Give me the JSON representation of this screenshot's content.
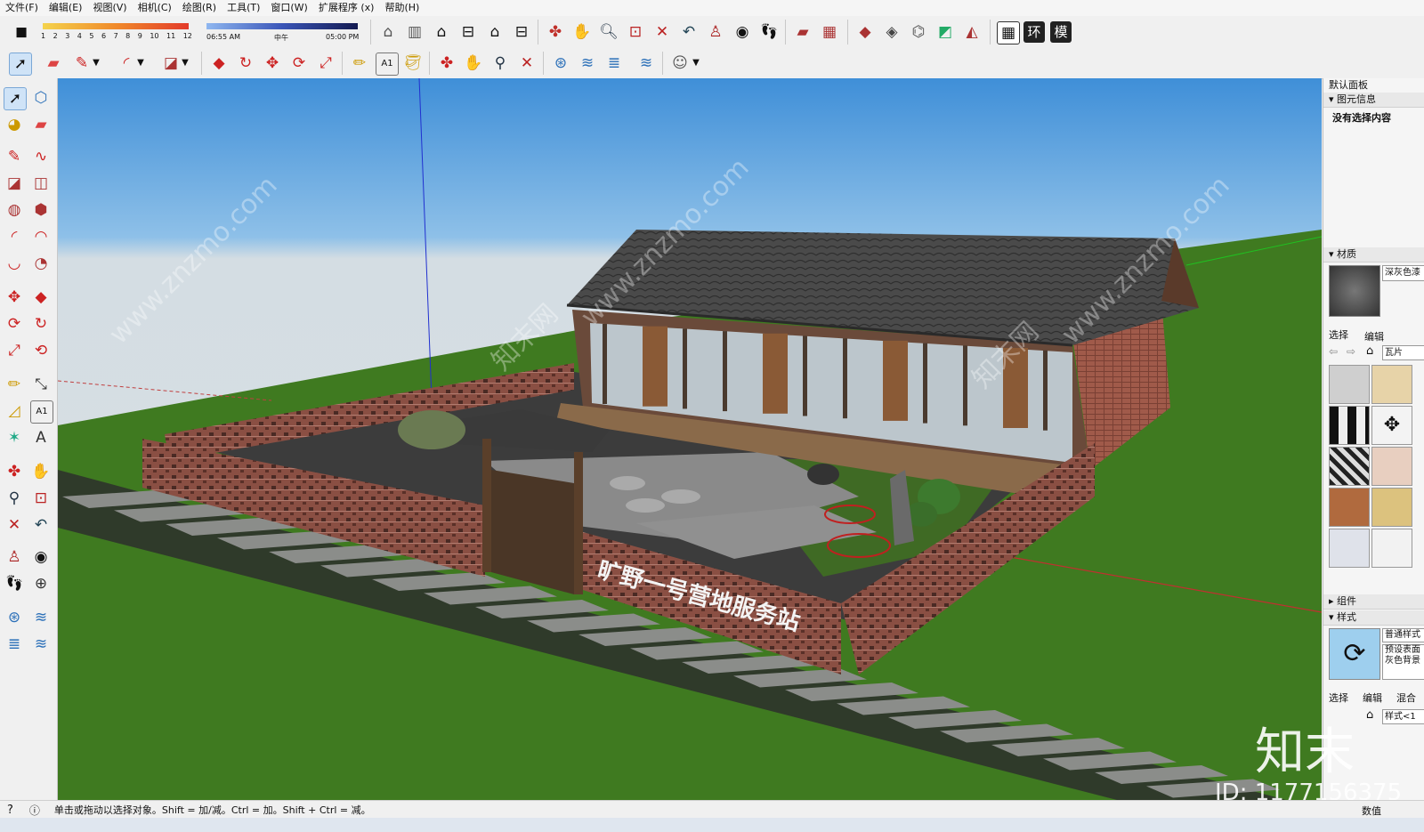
{
  "menu": [
    "文件(F)",
    "编辑(E)",
    "视图(V)",
    "相机(C)",
    "绘图(R)",
    "工具(T)",
    "窗口(W)",
    "扩展程序 (x)",
    "帮助(H)"
  ],
  "shadow": {
    "months": [
      "1",
      "2",
      "3",
      "4",
      "5",
      "6",
      "7",
      "8",
      "9",
      "10",
      "11",
      "12"
    ],
    "time_start": "06:55 AM",
    "time_mid": "中午",
    "time_end": "05:00 PM"
  },
  "toolbar": {
    "std_views_huan": "环",
    "std_views_mo": "模"
  },
  "panel": {
    "title": "默认面板",
    "entity_info_header": "图元信息",
    "entity_info_text": "没有选择内容",
    "materials_header": "材质",
    "material_name": "深灰色漆",
    "tab_select": "选择",
    "tab_edit": "编辑",
    "material_library": "瓦片",
    "components_header": "组件",
    "styles_header": "样式",
    "style_name": "普通样式",
    "style_desc": "预设表面\n灰色背景",
    "styles_tab_select": "选择",
    "styles_tab_edit": "编辑",
    "styles_tab_mix": "混合",
    "styles_library": "样式<1",
    "value_label": "数值"
  },
  "scene": {
    "sign_text": "旷野一号营地服务站",
    "watermark_site": "www.znzmo.com",
    "watermark_cn": "知末网"
  },
  "status": {
    "hint": "单击或拖动以选择对象。Shift = 加/减。Ctrl = 加。Shift + Ctrl = 减。"
  },
  "watermark": {
    "brand": "知末",
    "id_text": "ID: 1177156375"
  },
  "colors": {
    "sky_top": "#3f8fd8",
    "sky_bottom": "#d4dde3",
    "ground": "#3f7a20",
    "brick": "#8a4f43",
    "roof": "#454545"
  }
}
